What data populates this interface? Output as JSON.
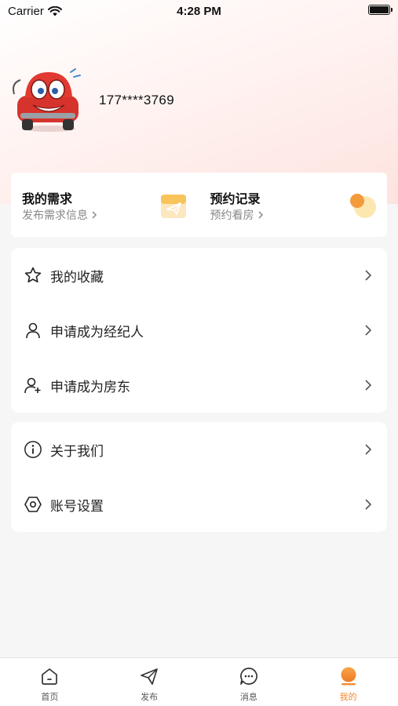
{
  "status_bar": {
    "carrier": "Carrier",
    "time": "4:28 PM"
  },
  "profile": {
    "phone": "177****3769"
  },
  "quick_actions": [
    {
      "title": "我的需求",
      "subtitle": "发布需求信息",
      "icon": "paper-plane-card-icon"
    },
    {
      "title": "预约记录",
      "subtitle": "预约看房",
      "icon": "orange-circle-icon"
    }
  ],
  "menu_group_1": [
    {
      "label": "我的收藏",
      "icon": "star-icon"
    },
    {
      "label": "申请成为经纪人",
      "icon": "person-icon"
    },
    {
      "label": "申请成为房东",
      "icon": "add-person-icon"
    }
  ],
  "menu_group_2": [
    {
      "label": "关于我们",
      "icon": "info-icon"
    },
    {
      "label": "账号设置",
      "icon": "hexagon-settings-icon"
    }
  ],
  "tabbar": [
    {
      "label": "首页",
      "icon": "home-icon"
    },
    {
      "label": "发布",
      "icon": "send-icon"
    },
    {
      "label": "消息",
      "icon": "message-icon"
    },
    {
      "label": "我的",
      "icon": "profile-dot-icon",
      "active": true
    }
  ],
  "colors": {
    "accent": "#f08a2e",
    "hero_tint": "#fde3df",
    "card": "#ffffff",
    "background": "#f6f6f6"
  }
}
